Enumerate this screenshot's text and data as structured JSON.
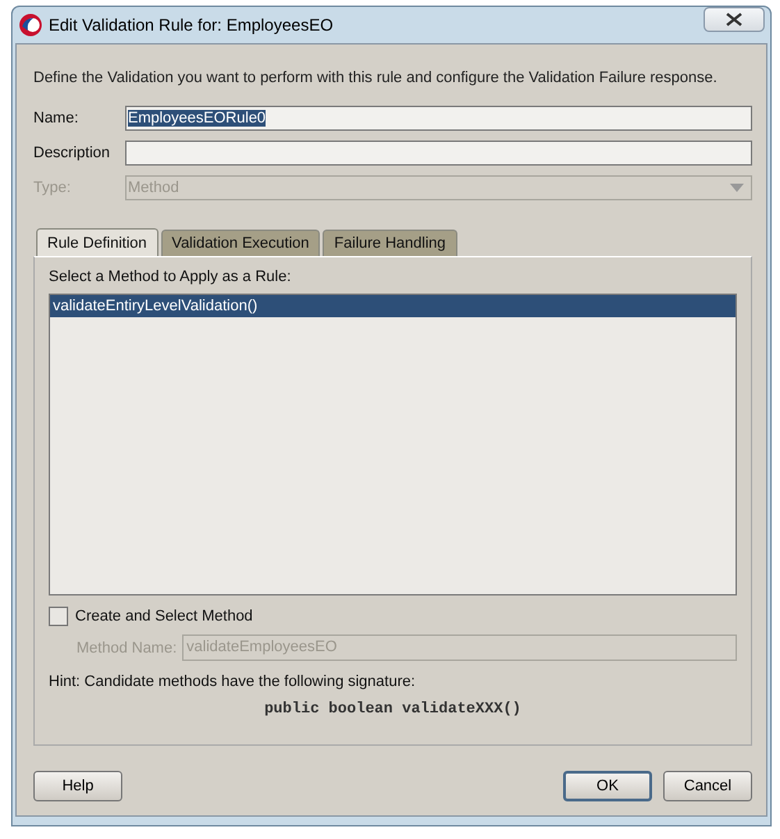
{
  "window": {
    "title": "Edit Validation Rule for: EmployeesEO"
  },
  "intro": "Define the Validation you want to perform with this rule and configure the Validation Failure response.",
  "fields": [
    {
      "kind": "text",
      "label": "Name:",
      "value": "EmployeesEORule0",
      "text_selected": true,
      "disabled": false
    },
    {
      "kind": "text",
      "label": "Description",
      "disabled": false
    },
    {
      "kind": "dropdown",
      "label": "Type:",
      "value": "Method",
      "disabled": true
    }
  ],
  "tabs": [
    {
      "label": "Rule Definition",
      "selected": true
    },
    {
      "label": "Validation Execution",
      "selected": false
    },
    {
      "label": "Failure Handling",
      "selected": false
    }
  ],
  "method_list": {
    "label": "Select a Method to Apply as a Rule:",
    "items": [
      {
        "label": "validateEntiryLevelValidation()",
        "selected": true
      }
    ]
  },
  "create_method": {
    "label": "Create and Select Method",
    "checked": false
  },
  "method_name": {
    "label": "Method Name:",
    "value": "validateEmployeesEO",
    "disabled": true
  },
  "hint": "Hint: Candidate methods have the following signature:",
  "signature": "public boolean validateXXX()",
  "buttons": [
    {
      "label": "Help",
      "default": false
    },
    {
      "label": "OK",
      "default": true
    },
    {
      "label": "Cancel",
      "default": false
    }
  ]
}
